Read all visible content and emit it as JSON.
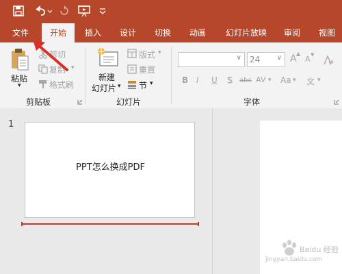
{
  "colors": {
    "accent": "#b7472a",
    "ribbon_bg": "#f3f3f3",
    "workspace_bg": "#e9e9e9",
    "arrow": "#d8302b"
  },
  "qat": {
    "icons": [
      "save-icon",
      "undo-icon",
      "redo-icon",
      "start-from-beginning-icon",
      "customize-qat-icon"
    ]
  },
  "tabs": [
    {
      "label": "文件"
    },
    {
      "label": "开始",
      "active": true
    },
    {
      "label": "插入"
    },
    {
      "label": "设计"
    },
    {
      "label": "切换"
    },
    {
      "label": "动画"
    },
    {
      "label": "幻灯片放映"
    },
    {
      "label": "审阅"
    },
    {
      "label": "视图"
    }
  ],
  "clipboard": {
    "paste": "粘贴",
    "cut": "剪切",
    "copy": "复制",
    "format_painter": "格式刷",
    "group": "剪贴板"
  },
  "slides_group": {
    "new_slide_line1": "新建",
    "new_slide_line2": "幻灯片",
    "layout": "版式",
    "reset": "重置",
    "section": "节",
    "group": "幻灯片"
  },
  "font_group": {
    "font_name": "",
    "font_size": "24",
    "group": "字体",
    "bold": "B",
    "italic": "I",
    "underline": "U",
    "shadow": "S",
    "strike": "abc",
    "spacing": "AV",
    "case": "Aa",
    "grow": "A",
    "shrink": "A",
    "text_label": "文"
  },
  "thumbnail": {
    "number": "1",
    "text": "PPT怎么换成PDF"
  },
  "watermark": {
    "brand": "Baidu 经验",
    "url": "jingyan.baidu.com"
  }
}
